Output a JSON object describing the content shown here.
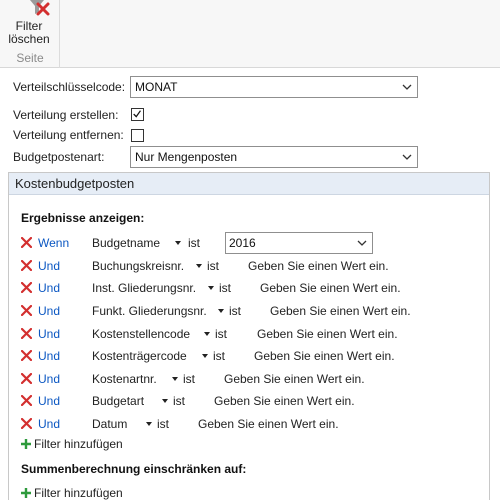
{
  "ribbon": {
    "clear_filter_label_line1": "Filter",
    "clear_filter_label_line2": "löschen",
    "group_label": "Seite"
  },
  "fields": {
    "distribution_key": {
      "label": "Verteilschlüsselcode:",
      "value": "MONAT"
    },
    "create_distribution": {
      "label": "Verteilung erstellen:",
      "checked": true
    },
    "remove_distribution": {
      "label": "Verteilung entfernen:",
      "checked": false
    },
    "budget_entry_type": {
      "label": "Budgetpostenart:",
      "value": "Nur Mengenposten"
    }
  },
  "section": {
    "title": "Kostenbudgetposten",
    "results_heading": "Ergebnisse anzeigen:",
    "filters": [
      {
        "conj": "Wenn",
        "field": "Budgetname",
        "op": "ist",
        "value": "2016"
      },
      {
        "conj": "Und",
        "field": "Buchungskreisnr.",
        "op": "ist",
        "placeholder": "Geben Sie einen Wert ein."
      },
      {
        "conj": "Und",
        "field": "Inst. Gliederungsnr.",
        "op": "ist",
        "placeholder": "Geben Sie einen Wert ein."
      },
      {
        "conj": "Und",
        "field": "Funkt. Gliederungsnr.",
        "op": "ist",
        "placeholder": "Geben Sie einen Wert ein."
      },
      {
        "conj": "Und",
        "field": "Kostenstellencode",
        "op": "ist",
        "placeholder": "Geben Sie einen Wert ein."
      },
      {
        "conj": "Und",
        "field": "Kostenträgercode",
        "op": "ist",
        "placeholder": "Geben Sie einen Wert ein."
      },
      {
        "conj": "Und",
        "field": "Kostenartnr.",
        "op": "ist",
        "placeholder": "Geben Sie einen Wert ein."
      },
      {
        "conj": "Und",
        "field": "Budgetart",
        "op": "ist",
        "placeholder": "Geben Sie einen Wert ein."
      },
      {
        "conj": "Und",
        "field": "Datum",
        "op": "ist",
        "placeholder": "Geben Sie einen Wert ein."
      }
    ],
    "add_filter_label": "Filter hinzufügen",
    "totals_heading": "Summenberechnung einschränken auf:",
    "add_filter_label_2": "Filter hinzufügen"
  },
  "colors": {
    "link": "#0b57c2",
    "remove_x": "#d32f2f",
    "add_plus": "#2e9a3c",
    "section_header": "#e6edf6"
  }
}
